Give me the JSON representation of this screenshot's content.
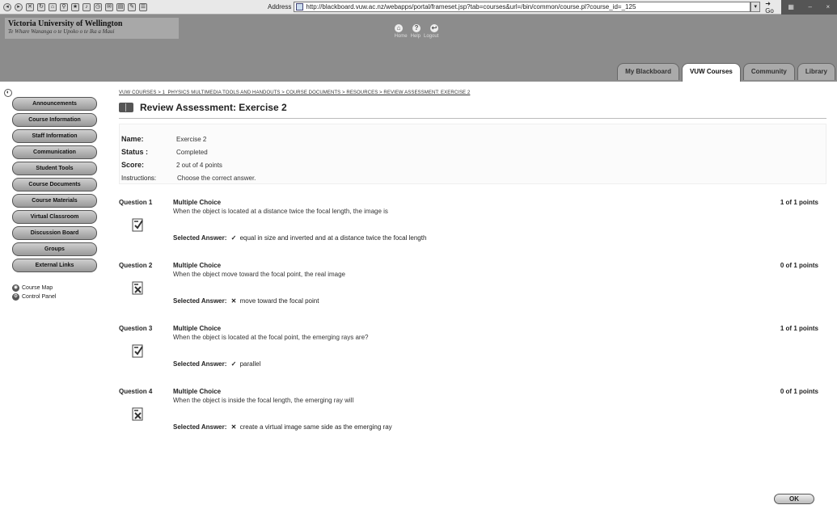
{
  "browser": {
    "address_label": "Address",
    "url": "http://blackboard.vuw.ac.nz/webapps/portal/frameset.jsp?tab=courses&url=/bin/common/course.pl?course_id=_125",
    "go_label": "Go"
  },
  "header": {
    "university": "Victoria University of Wellington",
    "tagline": "Te Whare Wananga o te Upoko o te Ika a Maui",
    "links": [
      "Home",
      "Help",
      "Logout"
    ],
    "tabs": [
      "My Blackboard",
      "VUW Courses",
      "Community",
      "Library"
    ],
    "active_tab": "VUW Courses"
  },
  "sidebar": {
    "items": [
      "Announcements",
      "Course Information",
      "Staff Information",
      "Communication",
      "Student Tools",
      "Course Documents",
      "Course Materials",
      "Virtual Classroom",
      "Discussion Board",
      "Groups",
      "External Links"
    ],
    "tools": [
      "Course Map",
      "Control Panel"
    ]
  },
  "breadcrumb": "VUW COURSES > 1_PHYSICS MULTIMEDIA TOOLS AND HANDOUTS > COURSE DOCUMENTS > RESOURCES > REVIEW ASSESSMENT: EXERCISE 2",
  "page_title": "Review Assessment: Exercise 2",
  "info": {
    "name_label": "Name:",
    "name_value": "Exercise 2",
    "status_label": "Status :",
    "status_value": "Completed",
    "score_label": "Score:",
    "score_value": "2 out of 4 points",
    "instructions_label": "Instructions:",
    "instructions_value": "Choose the correct answer."
  },
  "selected_answer_label": "Selected Answer:",
  "questions": [
    {
      "number": "Question 1",
      "type": "Multiple Choice",
      "points": "1 of 1 points",
      "text": "When the object is located at a distance twice the focal length, the image is",
      "mark": "✓",
      "answer": "equal in size and inverted and at a distance twice the focal length"
    },
    {
      "number": "Question 2",
      "type": "Multiple Choice",
      "points": "0 of 1 points",
      "text": "When the object move toward the focal point, the real image",
      "mark": "✕",
      "answer": "move toward the focal point"
    },
    {
      "number": "Question 3",
      "type": "Multiple Choice",
      "points": "1 of 1 points",
      "text": "When the object is located at the focal point, the emerging rays are?",
      "mark": "✓",
      "answer": "parallel"
    },
    {
      "number": "Question 4",
      "type": "Multiple Choice",
      "points": "0 of 1 points",
      "text": "When the object is inside the focal length, the emerging ray will",
      "mark": "✕",
      "answer": "create a virtual image same side as the emerging ray"
    }
  ],
  "ok_label": "OK"
}
